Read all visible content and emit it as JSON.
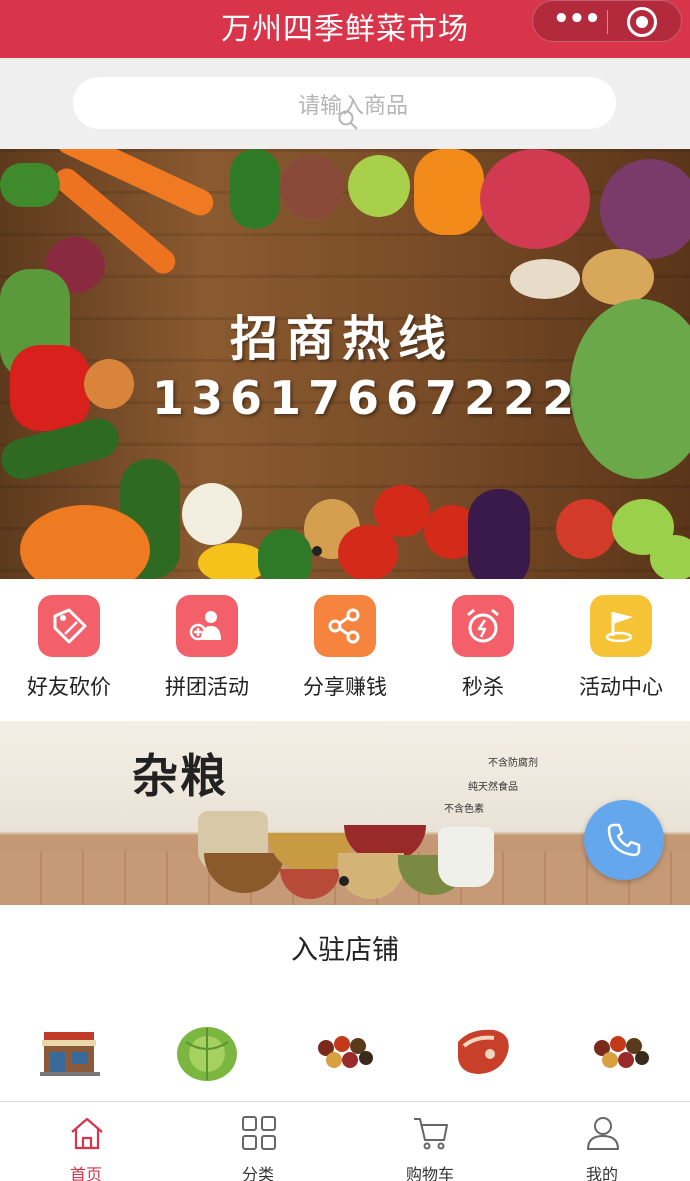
{
  "header": {
    "title": "万州四季鲜菜市场",
    "more_icon": "more-dots-icon",
    "target_icon": "target-icon"
  },
  "search": {
    "placeholder": "请输入商品"
  },
  "banner": {
    "title": "招商热线",
    "phone": "13617667222"
  },
  "quick_nav": [
    {
      "label": "好友砍价",
      "icon": "price-tag-icon",
      "color": "#f4606a"
    },
    {
      "label": "拼团活动",
      "icon": "group-icon",
      "color": "#f4606a"
    },
    {
      "label": "分享赚钱",
      "icon": "share-icon",
      "color": "#f6843e"
    },
    {
      "label": "秒杀",
      "icon": "alarm-clock-icon",
      "color": "#f4606a"
    },
    {
      "label": "活动中心",
      "icon": "flag-icon",
      "color": "#f7c336"
    }
  ],
  "grain_banner": {
    "title": "杂粮",
    "tags": [
      "不含防腐剂",
      "纯天然食品",
      "不含色素"
    ]
  },
  "stores": {
    "title": "入驻店铺"
  },
  "tabbar": [
    {
      "label": "首页",
      "icon": "home-icon",
      "active": true
    },
    {
      "label": "分类",
      "icon": "grid-icon",
      "active": false
    },
    {
      "label": "购物车",
      "icon": "cart-icon",
      "active": false
    },
    {
      "label": "我的",
      "icon": "user-icon",
      "active": false
    }
  ],
  "colors": {
    "brand": "#d8344a",
    "fab": "#64a7ec"
  }
}
